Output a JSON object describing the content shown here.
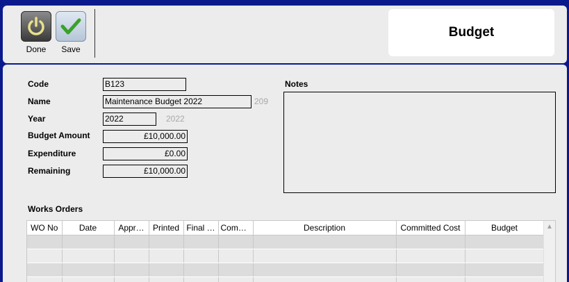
{
  "toolbar": {
    "done_label": "Done",
    "save_label": "Save",
    "title": "Budget"
  },
  "form": {
    "code": {
      "label": "Code",
      "value": "B123"
    },
    "name": {
      "label": "Name",
      "value": "Maintenance Budget 2022",
      "hint": "209"
    },
    "year": {
      "label": "Year",
      "value": "2022",
      "hint": "2022"
    },
    "budget_amount": {
      "label": "Budget Amount",
      "value": "£10,000.00"
    },
    "expenditure": {
      "label": "Expenditure",
      "value": "£0.00"
    },
    "remaining": {
      "label": "Remaining",
      "value": "£10,000.00"
    },
    "notes": {
      "label": "Notes",
      "value": ""
    }
  },
  "works_orders": {
    "label": "Works Orders",
    "columns": [
      "WO No",
      "Date",
      "Appr…",
      "Printed",
      "Final …",
      "Comp…",
      "Description",
      "Committed Cost",
      "Budget"
    ],
    "rows": []
  },
  "icons": {
    "done": "power-icon",
    "save": "checkmark-icon",
    "scroll_up": "chevron-up-icon"
  },
  "colors": {
    "window_background": "#0a1a8c",
    "panel": "#ececec",
    "save_check": "#3aa12a",
    "power_symbol": "#e8e08a"
  }
}
